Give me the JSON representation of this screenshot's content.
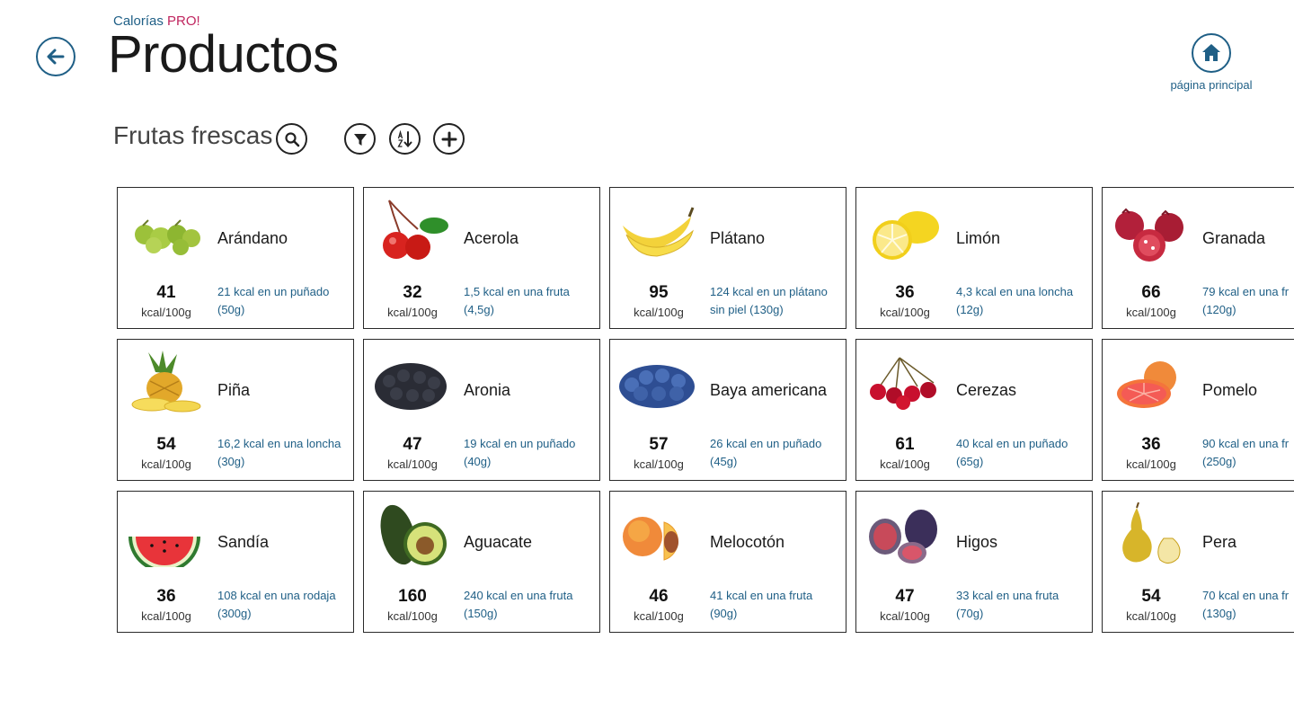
{
  "header": {
    "app_name": "Calorías",
    "app_suffix": "PRO!",
    "page_title": "Productos",
    "home_label": "página principal"
  },
  "toolbar": {
    "category": "Frutas frescas"
  },
  "colors": {
    "accent": "#1f5f86",
    "pro": "#c0255f"
  },
  "unit_label": "kcal/100g",
  "products": [
    {
      "name": "Arándano",
      "kcal": "41",
      "portion_1": "21 kcal en un puñado",
      "portion_2": "(50g)",
      "icon": "green-berries"
    },
    {
      "name": "Acerola",
      "kcal": "32",
      "portion_1": "1,5 kcal en una fruta",
      "portion_2": "(4,5g)",
      "icon": "red-cherry"
    },
    {
      "name": "Plátano",
      "kcal": "95",
      "portion_1": "124 kcal en un plátano",
      "portion_2": "sin piel (130g)",
      "icon": "banana"
    },
    {
      "name": "Limón",
      "kcal": "36",
      "portion_1": "4,3 kcal en una loncha",
      "portion_2": "(12g)",
      "icon": "lemon"
    },
    {
      "name": "Granada",
      "kcal": "66",
      "portion_1": "79 kcal en una fr",
      "portion_2": "(120g)",
      "icon": "pomegranate"
    },
    {
      "name": "Piña",
      "kcal": "54",
      "portion_1": "16,2 kcal en una loncha",
      "portion_2": "(30g)",
      "icon": "pineapple"
    },
    {
      "name": "Aronia",
      "kcal": "47",
      "portion_1": "19 kcal en un puñado",
      "portion_2": "(40g)",
      "icon": "black-berries"
    },
    {
      "name": "Baya americana",
      "kcal": "57",
      "portion_1": "26 kcal en un puñado",
      "portion_2": "(45g)",
      "icon": "blueberries"
    },
    {
      "name": "Cerezas",
      "kcal": "61",
      "portion_1": "40 kcal en un puñado",
      "portion_2": "(65g)",
      "icon": "cherries"
    },
    {
      "name": "Pomelo",
      "kcal": "36",
      "portion_1": "90 kcal en una fr",
      "portion_2": "(250g)",
      "icon": "grapefruit"
    },
    {
      "name": "Sandía",
      "kcal": "36",
      "portion_1": "108 kcal en una rodaja",
      "portion_2": "(300g)",
      "icon": "watermelon"
    },
    {
      "name": "Aguacate",
      "kcal": "160",
      "portion_1": "240 kcal en una fruta",
      "portion_2": "(150g)",
      "icon": "avocado"
    },
    {
      "name": "Melocotón",
      "kcal": "46",
      "portion_1": "41 kcal en una fruta",
      "portion_2": "(90g)",
      "icon": "peach"
    },
    {
      "name": "Higos",
      "kcal": "47",
      "portion_1": "33 kcal en una fruta",
      "portion_2": "(70g)",
      "icon": "figs"
    },
    {
      "name": "Pera",
      "kcal": "54",
      "portion_1": "70 kcal en una fr",
      "portion_2": "(130g)",
      "icon": "pear"
    }
  ]
}
